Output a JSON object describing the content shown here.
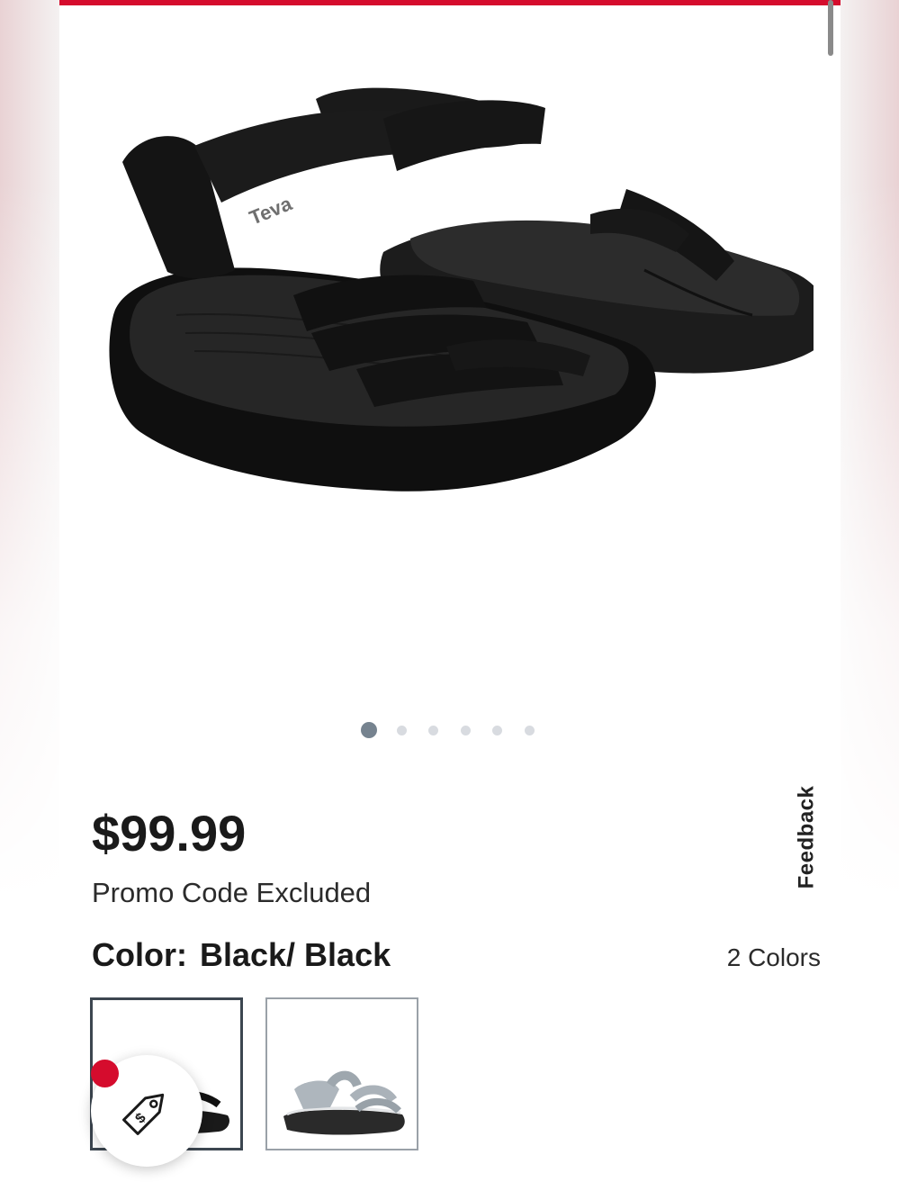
{
  "product": {
    "price": "$99.99",
    "promo_note": "Promo Code Excluded",
    "brand_logo": "Teva",
    "color_label": "Color:",
    "color_value": "Black/ Black",
    "color_count": "2 Colors"
  },
  "gallery": {
    "image_count": 6,
    "active_index": 0
  },
  "feedback": {
    "label": "Feedback"
  },
  "swatches": [
    {
      "name": "Black/ Black",
      "selected": true
    },
    {
      "name": "Grey",
      "selected": false
    }
  ],
  "colors": {
    "accent": "#d50c2d",
    "dot_active": "#76838f",
    "dot_inactive": "#d8dbe0"
  },
  "icons": {
    "promo_badge": "price-tag-icon"
  }
}
